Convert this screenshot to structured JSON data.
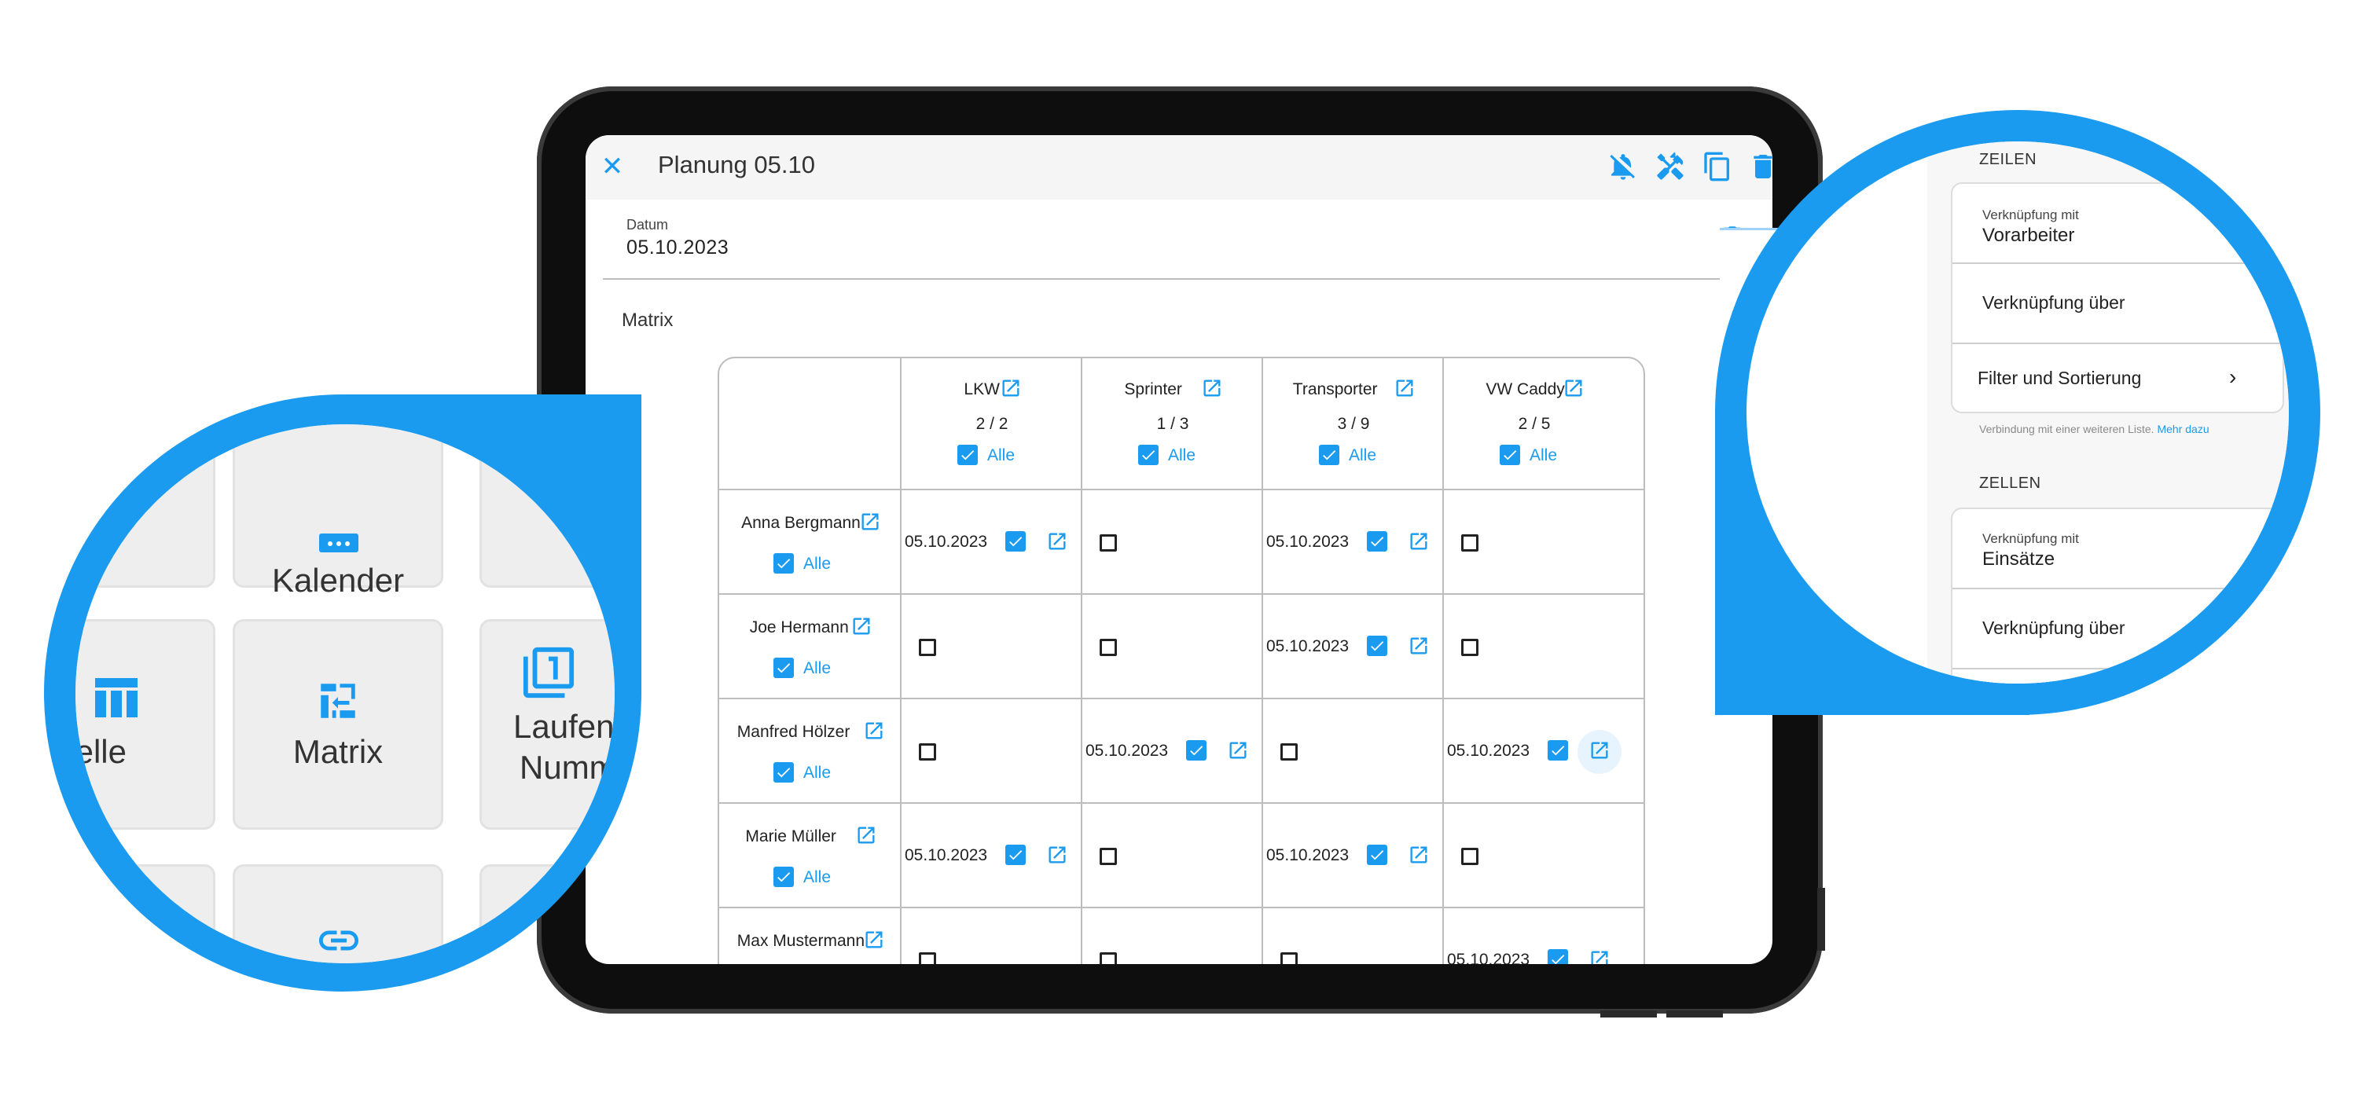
{
  "colors": {
    "accent": "#1a9bf0",
    "border": "#bdbdbd",
    "tile": "#eeeeee"
  },
  "dialog": {
    "title": "Planung 05.10",
    "icons": [
      "close-icon",
      "bell-off-icon",
      "tools-icon",
      "copy-icon",
      "trash-icon"
    ]
  },
  "date_field": {
    "label": "Datum",
    "value": "05.10.2023"
  },
  "matrix": {
    "label": "Matrix",
    "columns": [
      {
        "name": "LKW",
        "count": "2 / 2",
        "all": "Alle"
      },
      {
        "name": "Sprinter",
        "count": "1 / 3",
        "all": "Alle"
      },
      {
        "name": "Transporter",
        "count": "3 / 9",
        "all": "Alle"
      },
      {
        "name": "VW Caddy",
        "count": "2 / 5",
        "all": "Alle"
      }
    ],
    "rows": [
      {
        "name": "Anna Bergmann",
        "all": "Alle",
        "cells": [
          {
            "checked": true,
            "date": "05.10.2023"
          },
          {
            "checked": false,
            "date": ""
          },
          {
            "checked": true,
            "date": "05.10.2023"
          },
          {
            "checked": false,
            "date": ""
          }
        ]
      },
      {
        "name": "Joe Hermann",
        "all": "Alle",
        "cells": [
          {
            "checked": false,
            "date": ""
          },
          {
            "checked": false,
            "date": ""
          },
          {
            "checked": true,
            "date": "05.10.2023"
          },
          {
            "checked": false,
            "date": ""
          }
        ]
      },
      {
        "name": "Manfred Hölzer",
        "all": "Alle",
        "cells": [
          {
            "checked": false,
            "date": ""
          },
          {
            "checked": true,
            "date": "05.10.2023"
          },
          {
            "checked": false,
            "date": ""
          },
          {
            "checked": true,
            "date": "05.10.2023"
          }
        ]
      },
      {
        "name": "Marie Müller",
        "all": "Alle",
        "cells": [
          {
            "checked": true,
            "date": "05.10.2023"
          },
          {
            "checked": false,
            "date": ""
          },
          {
            "checked": true,
            "date": "05.10.2023"
          },
          {
            "checked": false,
            "date": ""
          }
        ]
      },
      {
        "name": "Max Mustermann",
        "all": "",
        "cells": [
          {
            "checked": false,
            "date": ""
          },
          {
            "checked": false,
            "date": ""
          },
          {
            "checked": false,
            "date": ""
          },
          {
            "checked": true,
            "date": "05.10.2023"
          }
        ]
      }
    ]
  },
  "zoom_left": {
    "tiles": [
      {
        "label": "Kalender",
        "icon": "calendar-icon"
      },
      {
        "label": "belle",
        "icon": "table-icon"
      },
      {
        "label": "Matrix",
        "icon": "matrix-icon"
      },
      {
        "label": "Laufen",
        "label2": "Numm",
        "icon": "running-number-icon"
      },
      {
        "label": "",
        "icon": "link-icon"
      }
    ]
  },
  "zoom_right": {
    "rows_section": "ZEILEN",
    "rows_link_label": "Verknüpfung mit",
    "rows_link_value": "Vorarbeiter",
    "rows_via": "Verknüpfung über",
    "rows_filter": "Filter und Sortierung",
    "hint": "Verbindung mit einer weiteren Liste.",
    "hint_link": "Mehr dazu",
    "cells_section": "ZELLEN",
    "cells_link_label": "Verknüpfung mit",
    "cells_link_value": "Einsätze",
    "cells_via": "Verknüpfung über"
  }
}
